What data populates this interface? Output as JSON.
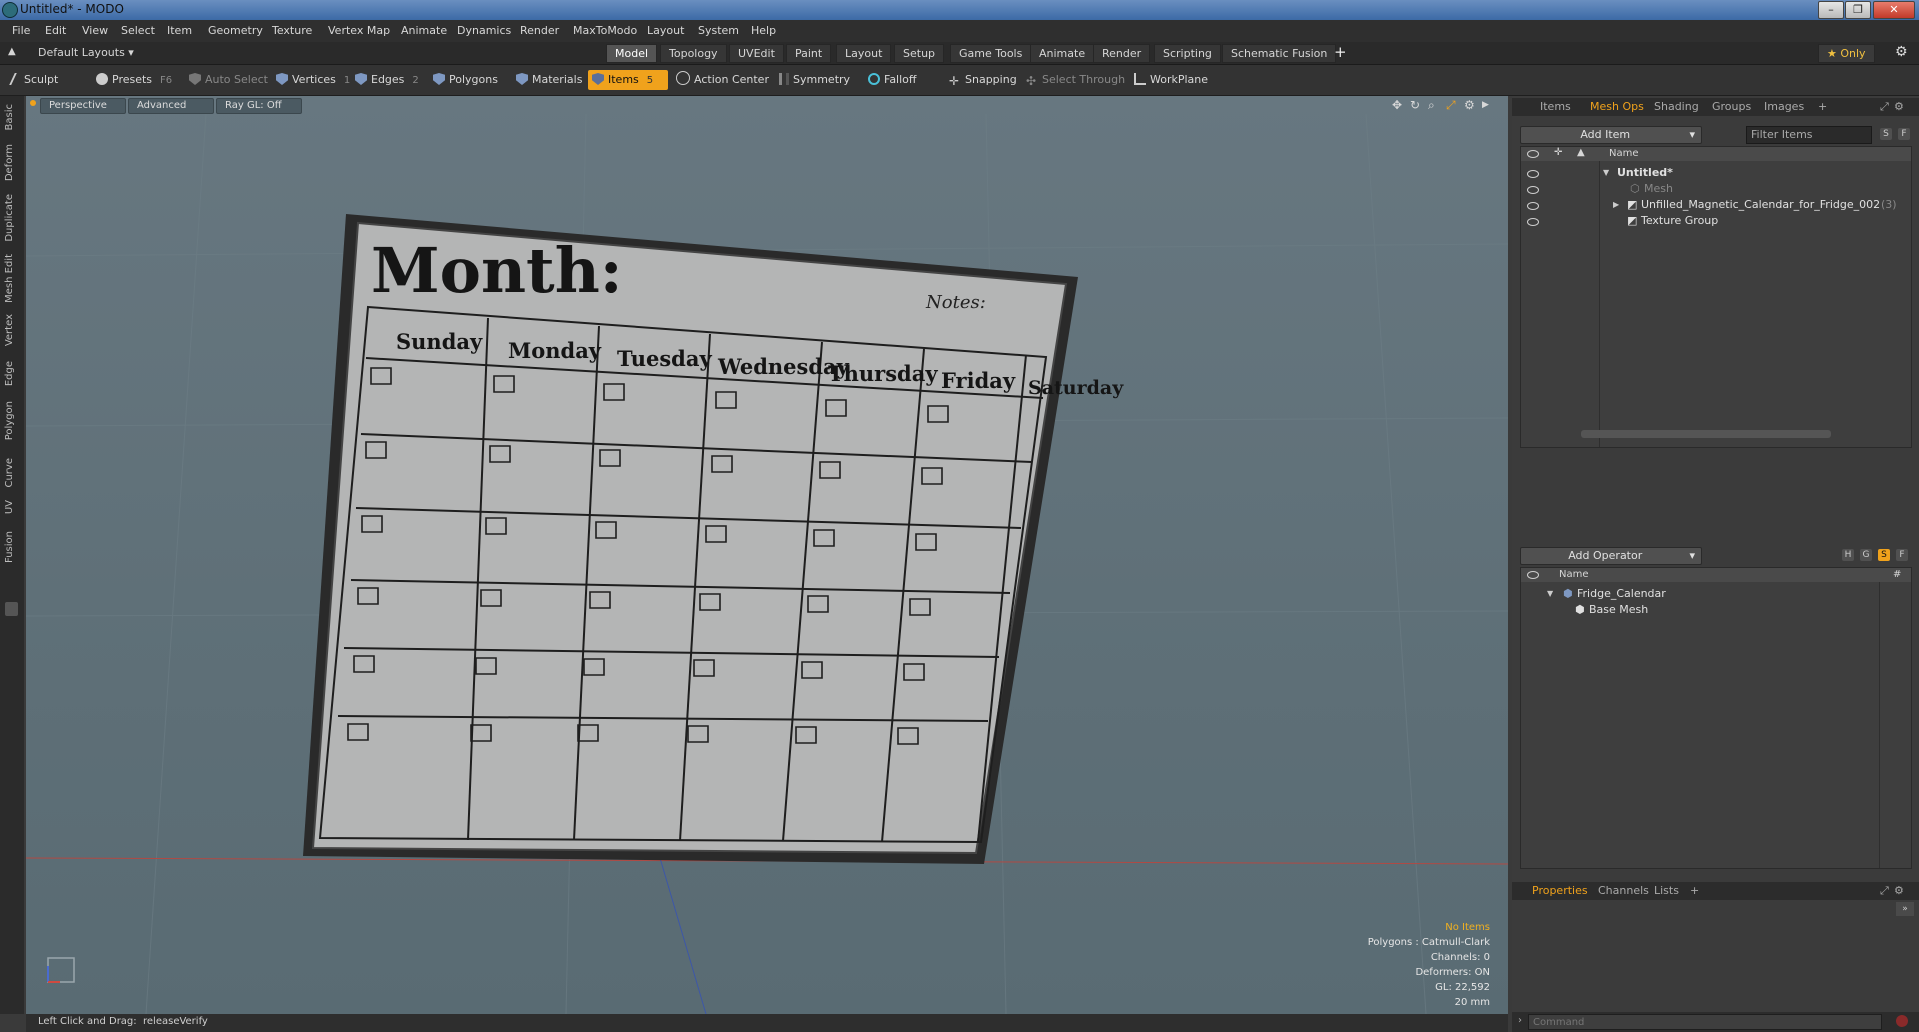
{
  "window": {
    "title": "Untitled* - MODO"
  },
  "menu": [
    "File",
    "Edit",
    "View",
    "Select",
    "Item",
    "Geometry",
    "Texture",
    "Vertex Map",
    "Animate",
    "Dynamics",
    "Render",
    "MaxToModo",
    "Layout",
    "System",
    "Help"
  ],
  "layout_selector": "Default Layouts ▾",
  "layout_tabs": [
    "Model",
    "Topology",
    "UVEdit",
    "Paint",
    "Layout",
    "Setup",
    "Game Tools",
    "Animate",
    "Render",
    "Scripting",
    "Schematic Fusion"
  ],
  "layout_tab_add": "+",
  "only_button": "★  Only",
  "toolbar": {
    "sculpt": "Sculpt",
    "presets": "Presets",
    "presets_key": "F6",
    "auto_select": "Auto Select",
    "vertices": "Vertices",
    "vertices_count": "1",
    "edges": "Edges",
    "edges_count": "2",
    "polygons": "Polygons",
    "materials": "Materials",
    "items": "Items",
    "items_count": "5",
    "action_center": "Action Center",
    "symmetry": "Symmetry",
    "falloff": "Falloff",
    "snapping": "Snapping",
    "select_through": "Select Through",
    "workplane": "WorkPlane"
  },
  "left_tabs": [
    "Basic",
    "Deform",
    "Duplicate",
    "Mesh Edit",
    "Vertex",
    "Edge",
    "Polygon",
    "Curve",
    "UV",
    "Fusion"
  ],
  "viewport": {
    "perspective": "Perspective",
    "advanced": "Advanced",
    "raygl": "Ray GL: Off",
    "info": {
      "no_items": "No Items",
      "polygons": "Polygons : Catmull-Clark",
      "channels": "Channels: 0",
      "deformers": "Deformers: ON",
      "gl": "GL: 22,592",
      "size": "20 mm"
    }
  },
  "calendar": {
    "title": "Month:",
    "notes": "Notes:",
    "days": [
      "Sunday",
      "Monday",
      "Tuesday",
      "Wednesday",
      "Thursday",
      "Friday",
      "Saturday"
    ]
  },
  "status": {
    "label": "Left Click and Drag:",
    "value": "releaseVerify"
  },
  "items_panel": {
    "tabs": [
      "Items",
      "Mesh Ops",
      "Shading",
      "Groups",
      "Images"
    ],
    "active_tab": "Mesh Ops",
    "add_item": "Add Item",
    "filter_items": "Filter Items",
    "s_btn": "S",
    "f_btn": "F",
    "name_col": "Name",
    "rows": [
      {
        "label": "Untitled*"
      },
      {
        "label": "Mesh"
      },
      {
        "label": "Unfilled_Magnetic_Calendar_for_Fridge_002",
        "count": "(3)"
      },
      {
        "label": "Texture Group"
      }
    ]
  },
  "operator_panel": {
    "add_operator": "Add Operator",
    "h_btn": "H",
    "g_btn": "G",
    "s_btn": "S",
    "f_btn": "F",
    "name_col": "Name",
    "hash_col": "#",
    "rows": [
      {
        "label": "Fridge_Calendar"
      },
      {
        "label": "Base Mesh"
      }
    ]
  },
  "bottom_tabs": [
    "Properties",
    "Channels",
    "Lists"
  ],
  "command": {
    "placeholder": "Command"
  }
}
